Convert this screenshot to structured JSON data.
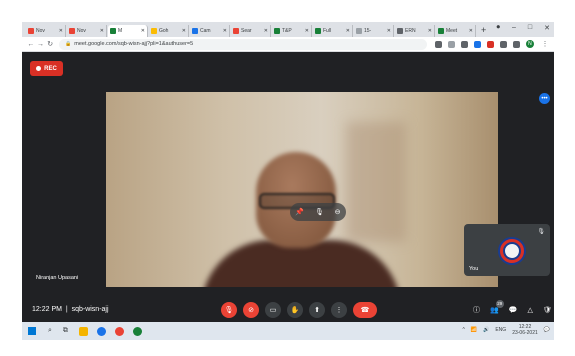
{
  "browser": {
    "tabs": [
      {
        "label": "Nov",
        "color": "#ea4335",
        "active": false
      },
      {
        "label": "Nov",
        "color": "#ea4335",
        "active": false
      },
      {
        "label": "M",
        "color": "#188038",
        "active": true
      },
      {
        "label": "Goh",
        "color": "#fbbc04",
        "active": false
      },
      {
        "label": "Cam",
        "color": "#1a73e8",
        "active": false
      },
      {
        "label": "Sear",
        "color": "#ea4335",
        "active": false
      },
      {
        "label": "T&P",
        "color": "#188038",
        "active": false
      },
      {
        "label": "Full",
        "color": "#188038",
        "active": false
      },
      {
        "label": "15-",
        "color": "#9aa0a6",
        "active": false
      },
      {
        "label": "ERN",
        "color": "#5f6368",
        "active": false
      },
      {
        "label": "Meet",
        "color": "#188038",
        "active": false
      }
    ],
    "new_tab": "+",
    "url": "meet.google.com/sqb-wisn-ajj?pli=1&authuser=5",
    "profile_initial": "N"
  },
  "meeting": {
    "rec_label": "REC",
    "main_participant": "Niranjan Upasani",
    "self_label": "You",
    "time": "12:22 PM",
    "code": "sqb-wisn-ajj",
    "people_count": "29"
  },
  "colors": {
    "rec": "#d93025",
    "end_call": "#ea4335",
    "meet_bg": "#202124"
  },
  "taskbar": {
    "lang": "ENG",
    "time": "12:22",
    "date": "23-06-2021"
  }
}
